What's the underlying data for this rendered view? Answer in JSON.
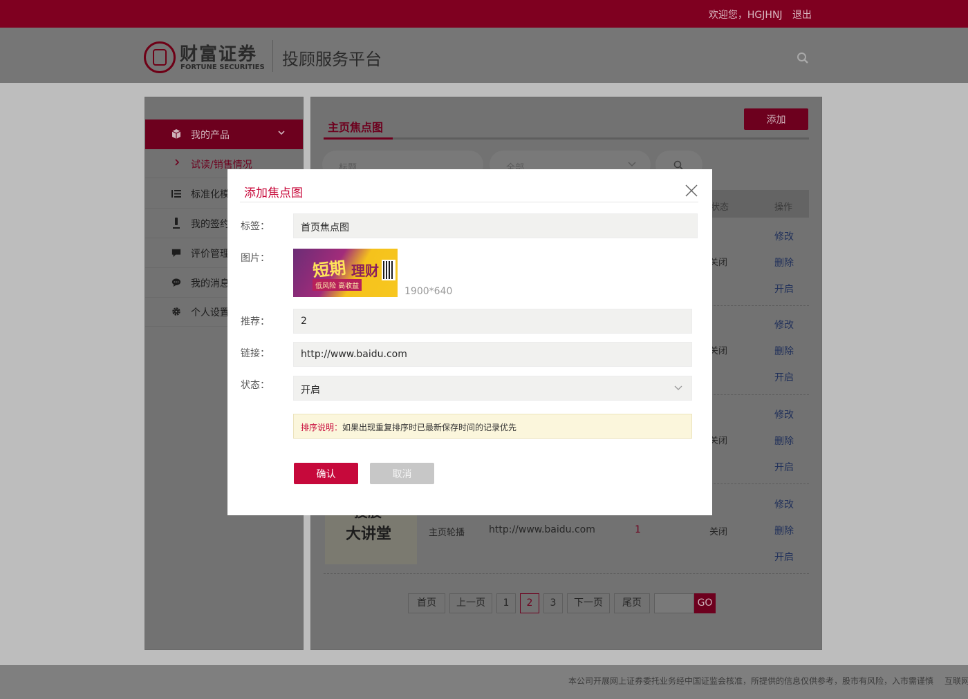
{
  "topbar": {
    "greeting": "欢迎您，HGJHNJ",
    "logout": "退出"
  },
  "header": {
    "logo_cn": "财富证券",
    "logo_en": "FORTUNE SECURITIES",
    "platform": "投顾服务平台",
    "search_icon": "search-icon"
  },
  "sidebar": {
    "items": [
      {
        "label": "我的产品",
        "icon": "cube-icon",
        "active": true
      },
      {
        "label": "试读/销售情况",
        "icon": "chevron-right-icon",
        "sub": true
      },
      {
        "label": "标准化模",
        "icon": "list-icon"
      },
      {
        "label": "我的签约",
        "icon": "pen-icon"
      },
      {
        "label": "评价管理",
        "icon": "comment-icon"
      },
      {
        "label": "我的消息",
        "icon": "message-icon"
      },
      {
        "label": "个人设置",
        "icon": "gear-icon"
      }
    ]
  },
  "main": {
    "tab": "主页焦点图",
    "add_label": "添加",
    "filter": {
      "title_placeholder": "标题",
      "status_value": "全部"
    },
    "columns": {
      "status": "状态",
      "operation": "操作"
    },
    "rows": [
      {
        "status": "关闭",
        "ops": [
          "修改",
          "删除",
          "开启"
        ]
      },
      {
        "status": "关闭",
        "ops": [
          "修改",
          "删除",
          "开启"
        ]
      },
      {
        "status": "关闭",
        "ops": [
          "修改",
          "删除",
          "开启"
        ]
      },
      {
        "thumb_text": [
          "投股",
          "大讲堂"
        ],
        "type": "主页轮播",
        "link": "http://www.baidu.com",
        "sort": "1",
        "status": "关闭",
        "ops": [
          "修改",
          "删除",
          "开启"
        ]
      }
    ],
    "pager": {
      "first": "首页",
      "prev": "上一页",
      "pages": [
        "1",
        "2",
        "3"
      ],
      "current": "2",
      "next": "下一页",
      "last": "尾页",
      "go": "GO"
    }
  },
  "modal": {
    "title": "添加焦点图",
    "labels": {
      "tag": "标签：",
      "image": "图片：",
      "recommend": "推荐：",
      "link": "链接：",
      "status": "状态："
    },
    "values": {
      "tag": "首页焦点图",
      "recommend": "2",
      "link": "http://www.baidu.com",
      "status": "开启"
    },
    "image": {
      "banner_main": "短期",
      "banner_side": "理财",
      "banner_sub": "低风险 高收益",
      "size": "1900*640"
    },
    "note": {
      "key": "排序说明：",
      "text": "如果出现重复排序时已最新保存时间的记录优先"
    },
    "confirm": "确认",
    "cancel": "取消"
  },
  "footer": {
    "text": "本公司开展网上证券委托业务经中国证监会核准，所提供的信息仅供参考，股市有风险，入市需谨慎",
    "text2": "互联网"
  },
  "colors": {
    "brand": "#c6093b",
    "link": "#3a5ba9"
  }
}
